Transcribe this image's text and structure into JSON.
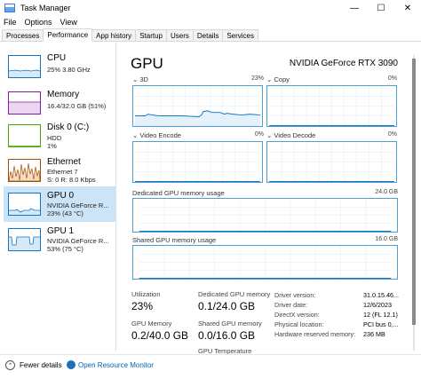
{
  "window": {
    "title": "Task Manager",
    "minimize": "—",
    "maximize": "☐",
    "close": "✕"
  },
  "menu": [
    "File",
    "Options",
    "View"
  ],
  "tabs": [
    "Processes",
    "Performance",
    "App history",
    "Startup",
    "Users",
    "Details",
    "Services"
  ],
  "active_tab": "Performance",
  "sidebar": [
    {
      "title": "CPU",
      "line1": "25% 3.80 GHz",
      "line2": "",
      "line3": ""
    },
    {
      "title": "Memory",
      "line1": "16.4/32.0 GB (51%)",
      "line2": "",
      "line3": ""
    },
    {
      "title": "Disk 0 (C:)",
      "line1": "HDD",
      "line2": "1%",
      "line3": ""
    },
    {
      "title": "Ethernet",
      "line1": "Ethernet 7",
      "line2": "S: 0 R: 8.0 Kbps",
      "line3": ""
    },
    {
      "title": "GPU 0",
      "line1": "NVIDIA GeForce R...",
      "line2": "23% (43 °C)",
      "line3": ""
    },
    {
      "title": "GPU 1",
      "line1": "NVIDIA GeForce R...",
      "line2": "53% (75 °C)",
      "line3": ""
    }
  ],
  "sidebar_selected_index": 4,
  "sidebar_colors": {
    "cpu": "#1174c4",
    "memory": "#8b19a6",
    "disk": "#4da60c",
    "ethernet": "#a74f01",
    "gpu": "#1174c4"
  },
  "main": {
    "title": "GPU",
    "model": "NVIDIA GeForce RTX 3090",
    "engines": [
      {
        "label": "3D",
        "pct": "23%"
      },
      {
        "label": "Copy",
        "pct": "0%"
      },
      {
        "label": "Video Encode",
        "pct": "0%"
      },
      {
        "label": "Video Decode",
        "pct": "0%"
      }
    ],
    "shared_label_dedicated": "Dedicated GPU memory usage",
    "dedicated_max": "24.0 GB",
    "shared_label": "Shared GPU memory usage",
    "shared_max": "16.0 GB"
  },
  "stats": {
    "utilization_label": "Utilization",
    "utilization": "23%",
    "dedicated_label": "Dedicated GPU memory",
    "dedicated": "0.1/24.0 GB",
    "gpu_memory_label": "GPU Memory",
    "gpu_memory": "0.2/40.0 GB",
    "shared_label": "Shared GPU memory",
    "shared": "0.0/16.0 GB",
    "gpu_temp_label": "GPU Temperature"
  },
  "details": [
    {
      "key": "Driver version:",
      "value": "31.0.15.46..."
    },
    {
      "key": "Driver date:",
      "value": "12/6/2023"
    },
    {
      "key": "DirectX version:",
      "value": "12 (FL 12.1)"
    },
    {
      "key": "Physical location:",
      "value": "PCI bus 0,..."
    },
    {
      "key": "Hardware reserved memory:",
      "value": "236 MB"
    }
  ],
  "footer": {
    "fewer_details": "Fewer details",
    "open_monitor": "Open Resource Monitor"
  },
  "accent": "#4f9fd1"
}
